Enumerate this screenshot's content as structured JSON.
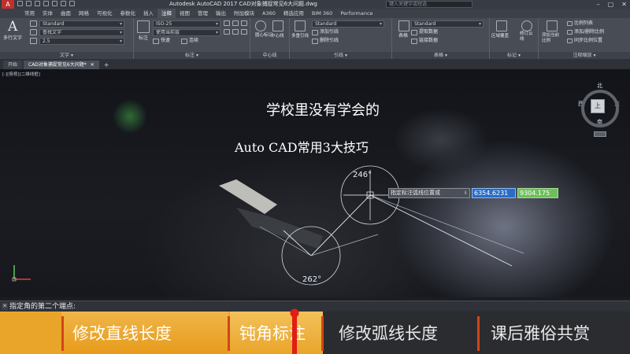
{
  "titlebar": {
    "logo": "A",
    "title": "Autodesk AutoCAD 2017    CAD对象捕捉常见6大问题.dwg",
    "search_placeholder": "键入关键字或短语",
    "min": "–",
    "max": "▢",
    "close": "✕"
  },
  "ribbon_tabs": [
    "常用",
    "实体",
    "曲面",
    "网格",
    "可视化",
    "参数化",
    "插入",
    "注释",
    "视图",
    "管理",
    "输出",
    "附加模块",
    "A360",
    "精选应用",
    "BIM 360",
    "Performance"
  ],
  "ribbon": {
    "text_panel": {
      "big_label": "多行文字",
      "style": "Standard",
      "find": "查找文字",
      "height": "2.5",
      "label": "文字 ▾"
    },
    "dim_panel": {
      "style": "ISO-25",
      "layer": "使用当前层",
      "quick": "快速",
      "continue": "连续",
      "label": "标注 ▾",
      "label_big": "标注"
    },
    "centerline_panel": {
      "center_mark": "圆心标记",
      "centerline": "中心线",
      "label": "中心线"
    },
    "leader_panel": {
      "big_label": "多重引线",
      "style": "Standard",
      "add": "添加引线",
      "remove": "删除引线",
      "label": "引线 ▾"
    },
    "table_panel": {
      "big_label": "表格",
      "style": "Standard",
      "extract": "提取数据",
      "link": "链接数据",
      "label": "表格 ▾"
    },
    "markup_panel": {
      "area_mask": "区域覆盖",
      "revcloud": "修订云线",
      "label": "标记 ▾"
    },
    "scale_panel": {
      "add_current": "添加当前比例",
      "list": "比例列表",
      "add_delete": "添加/删除比例",
      "sync": "同步比例位置",
      "label": "注释缩放 ▾"
    }
  },
  "doc_tabs": {
    "start": "开始",
    "file": "CAD对象捕捉常见6大问题*",
    "close": "✕",
    "plus": "+"
  },
  "canvas": {
    "viewport_label": "[-][俯视][二维线框]",
    "overlay_line1": "学校里没有学会的",
    "overlay_line2": "Auto CAD常用3大技巧",
    "angle_top": "246°",
    "angle_bottom": "262°",
    "tooltip": "指定标注弧线位置或",
    "tooltip_arrow": "⇩",
    "coord_x": "6354.6231",
    "coord_y": "9304.175"
  },
  "viewcube": {
    "north": "北",
    "south": "南",
    "east": "东",
    "west": "西",
    "face": "上"
  },
  "command": {
    "close": "✕",
    "text": "指定角的第二个端点:"
  },
  "chapters": [
    {
      "label": "修改直线长度"
    },
    {
      "label": "钝角标注"
    },
    {
      "label": "修改弧线长度"
    },
    {
      "label": "课后雅俗共赏"
    }
  ],
  "colors": {
    "accent_orange": "#e9a52a",
    "separator_red": "#d2451a",
    "coord_x_bg": "#2a6dc6",
    "coord_y_bg": "#6ebf5a"
  }
}
